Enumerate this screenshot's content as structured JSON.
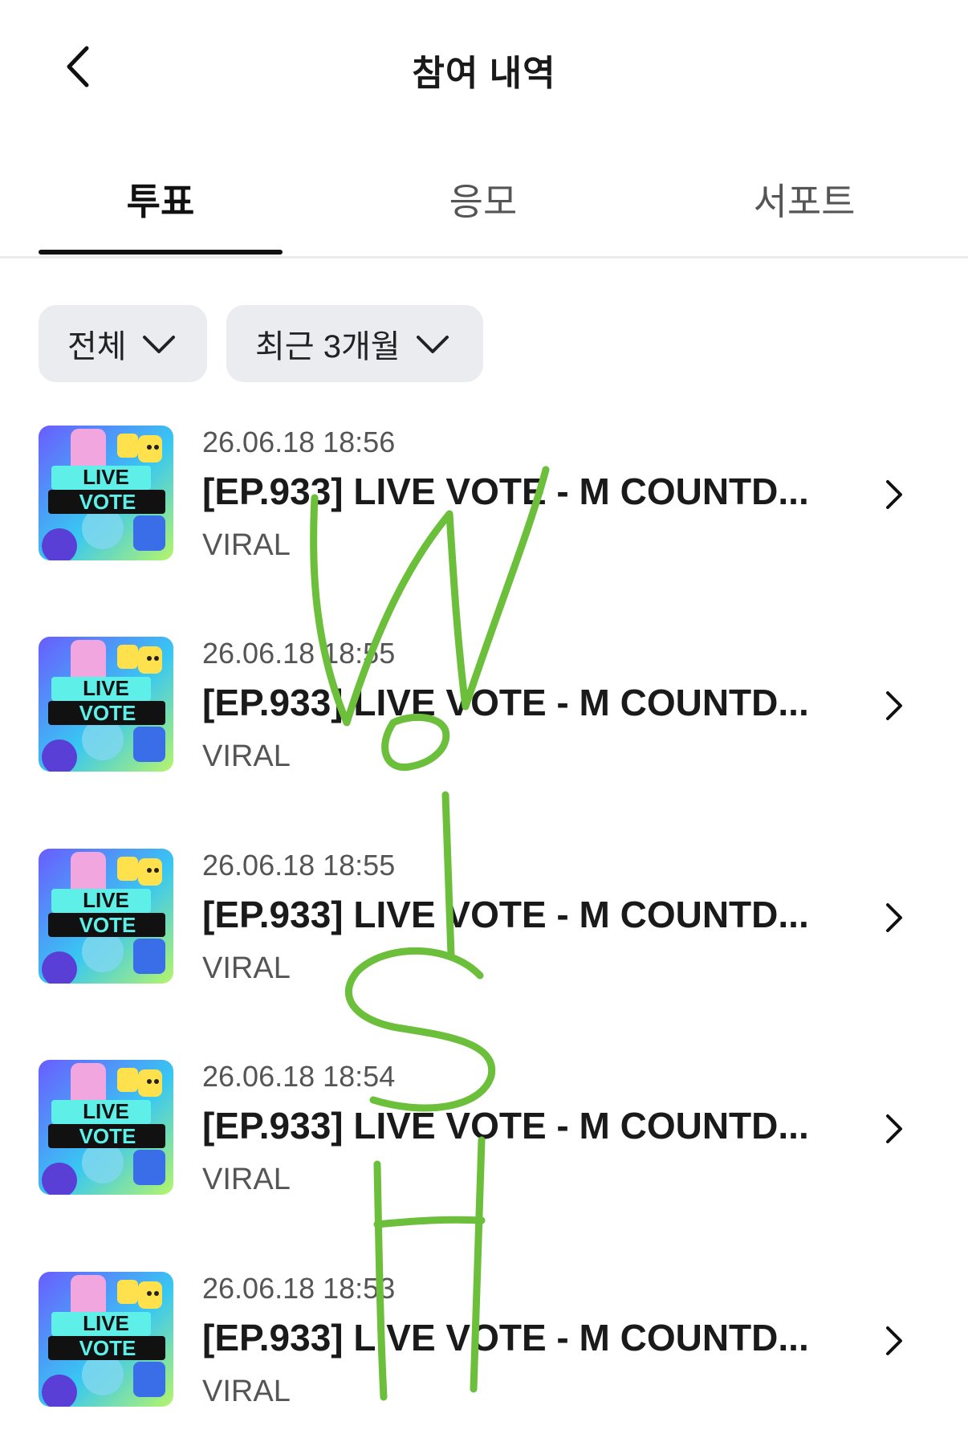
{
  "header": {
    "title": "참여 내역",
    "back_icon": "chevron-left-icon"
  },
  "tabs": [
    {
      "label": "투표",
      "active": true
    },
    {
      "label": "응모",
      "active": false
    },
    {
      "label": "서포트",
      "active": false
    }
  ],
  "filters": [
    {
      "label": "전체",
      "icon": "chevron-down-icon"
    },
    {
      "label": "최근 3개월",
      "icon": "chevron-down-icon"
    }
  ],
  "items": [
    {
      "date": "26.06.18 18:56",
      "title": "[EP.933] LIVE VOTE - M COUNTD...",
      "source": "VIRAL"
    },
    {
      "date": "26.06.18 18:55",
      "title": "[EP.933] LIVE VOTE - M COUNTD...",
      "source": "VIRAL"
    },
    {
      "date": "26.06.18 18:55",
      "title": "[EP.933] LIVE VOTE - M COUNTD...",
      "source": "VIRAL"
    },
    {
      "date": "26.06.18 18:54",
      "title": "[EP.933] LIVE VOTE - M COUNTD...",
      "source": "VIRAL"
    },
    {
      "date": "26.06.18 18:53",
      "title": "[EP.933] LIVE VOTE - M COUNTD...",
      "source": "VIRAL"
    }
  ],
  "thumbnail": {
    "line1": "LIVE",
    "line2": "VOTE"
  },
  "colors": {
    "accent": "#111111",
    "chip_bg": "#ebecf0",
    "scribble": "#6cbf3a"
  }
}
